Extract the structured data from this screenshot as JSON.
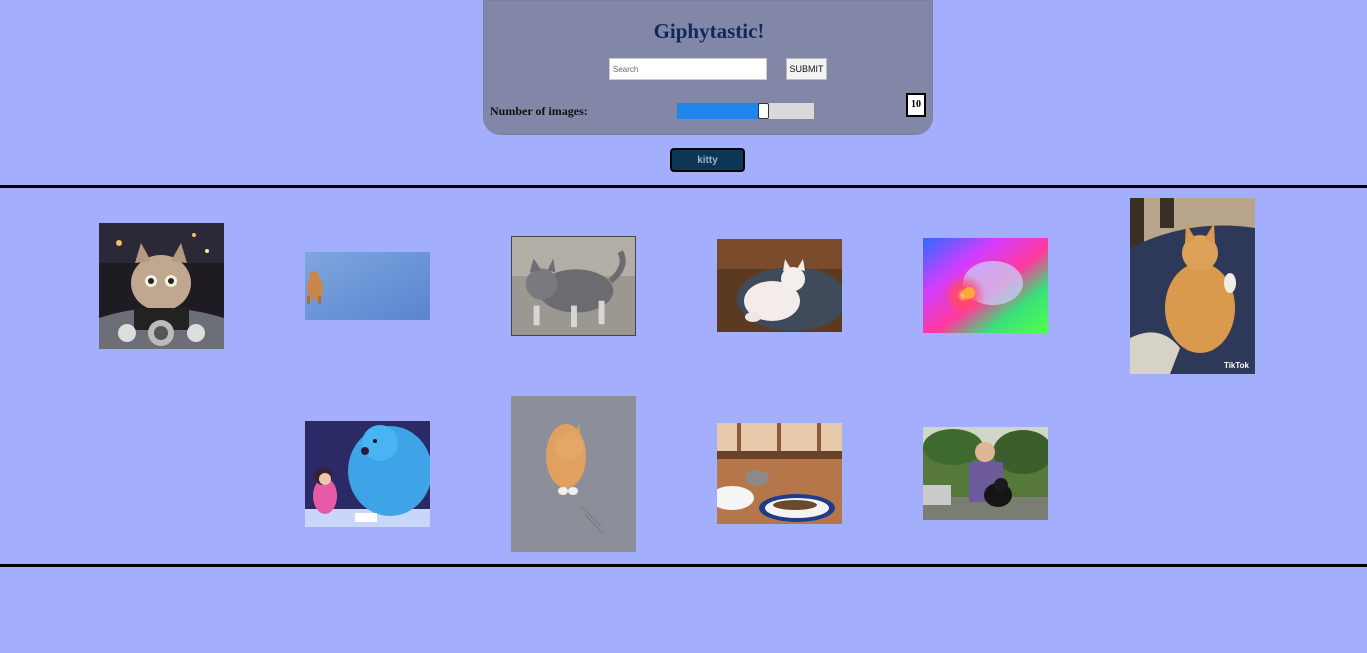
{
  "header": {
    "title": "Giphytastic!",
    "search_placeholder": "Search",
    "search_value": "",
    "submit_label": "SUBMIT",
    "num_images_label": "Number of images:",
    "num_images_value": "10",
    "slider_fraction": 0.64,
    "slider_color": "#1d87ee"
  },
  "tags": [
    {
      "label": "kitty"
    }
  ],
  "gifs": [
    {
      "name": "gif-kitten-motorcycle",
      "label": ""
    },
    {
      "name": "gif-kitten-flying-sky",
      "label": ""
    },
    {
      "name": "gif-gray-kitten-hopping",
      "label": ""
    },
    {
      "name": "gif-white-kitten-on-pillow",
      "label": ""
    },
    {
      "name": "gif-rainbow-kitten",
      "label": ""
    },
    {
      "name": "gif-orange-cat-on-bed",
      "label": "TikTok"
    },
    {
      "name": "gif-boo-and-sulley",
      "label": ""
    },
    {
      "name": "gif-orange-kitten-looking-up",
      "label": ""
    },
    {
      "name": "gif-cat-peeking-at-fish",
      "label": ""
    },
    {
      "name": "gif-man-holding-cat",
      "label": ""
    }
  ],
  "colors": {
    "page_bg": "#a3aefd",
    "panel_bg": "#8287a7",
    "title": "#0f2a5a",
    "tag_bg": "#0d3555"
  }
}
